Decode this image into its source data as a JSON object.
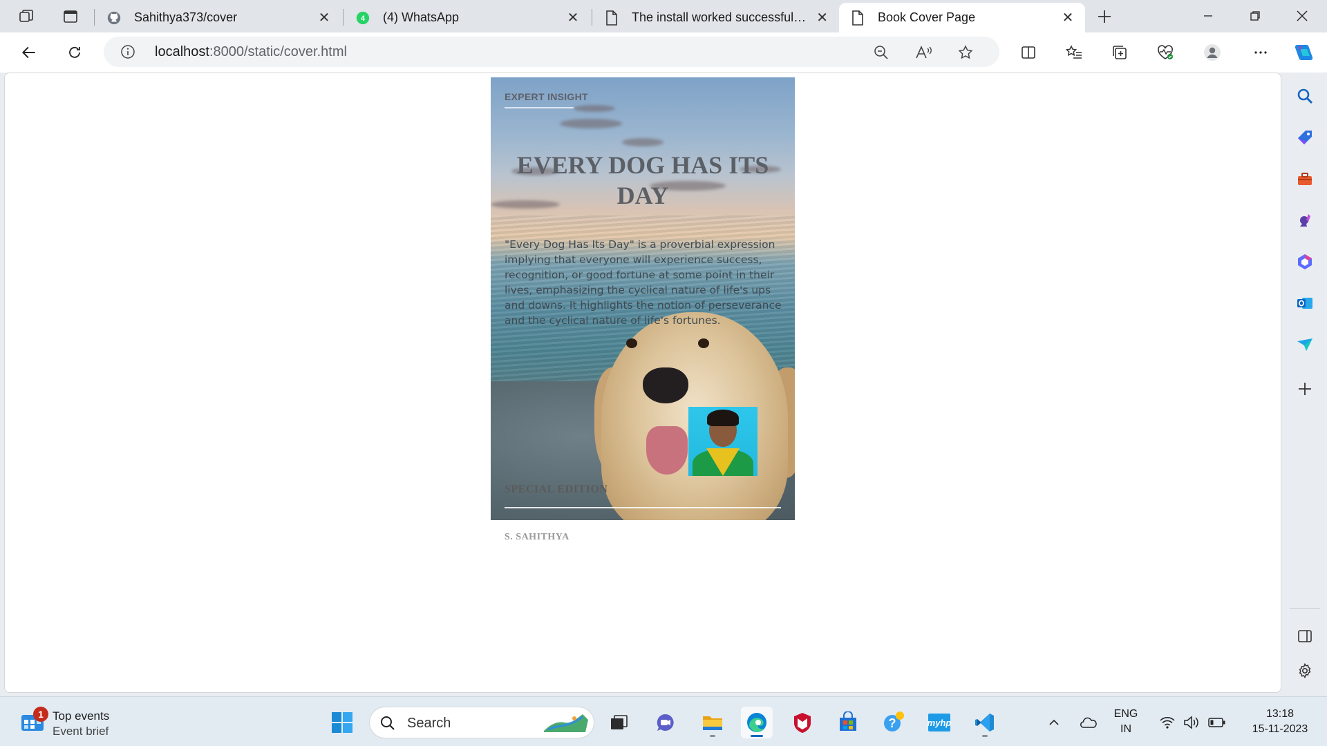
{
  "browser": {
    "tabs": [
      {
        "title": "Sahithya373/cover",
        "icon": "github-icon"
      },
      {
        "title": "(4) WhatsApp",
        "icon": "whatsapp-icon",
        "badge": "4"
      },
      {
        "title": "The install worked successfully! C",
        "icon": "page-icon"
      },
      {
        "title": "Book Cover Page",
        "icon": "page-icon",
        "active": true
      }
    ],
    "address": {
      "host": "localhost",
      "path": ":8000/static/cover.html"
    }
  },
  "cover": {
    "label": "EXPERT INSIGHT",
    "title": "EVERY DOG HAS ITS DAY",
    "description": "\"Every Dog Has Its Day\" is a proverbial expression implying that everyone will experience success, recognition, or good fortune at some point in their lives, emphasizing the cyclical nature of life's ups and downs. It highlights the notion of perseverance and the cyclical nature of life's fortunes.",
    "edition": "SPECIAL EDITION",
    "author": "S. SAHITHYA"
  },
  "taskbar": {
    "widget": {
      "title": "Top events",
      "subtitle": "Event brief",
      "badge": "1"
    },
    "search_placeholder": "Search",
    "language": {
      "line1": "ENG",
      "line2": "IN"
    },
    "clock": {
      "time": "13:18",
      "date": "15-11-2023"
    }
  },
  "colors": {
    "accent": "#0067c0",
    "edge_blue": "#0a84d6"
  }
}
